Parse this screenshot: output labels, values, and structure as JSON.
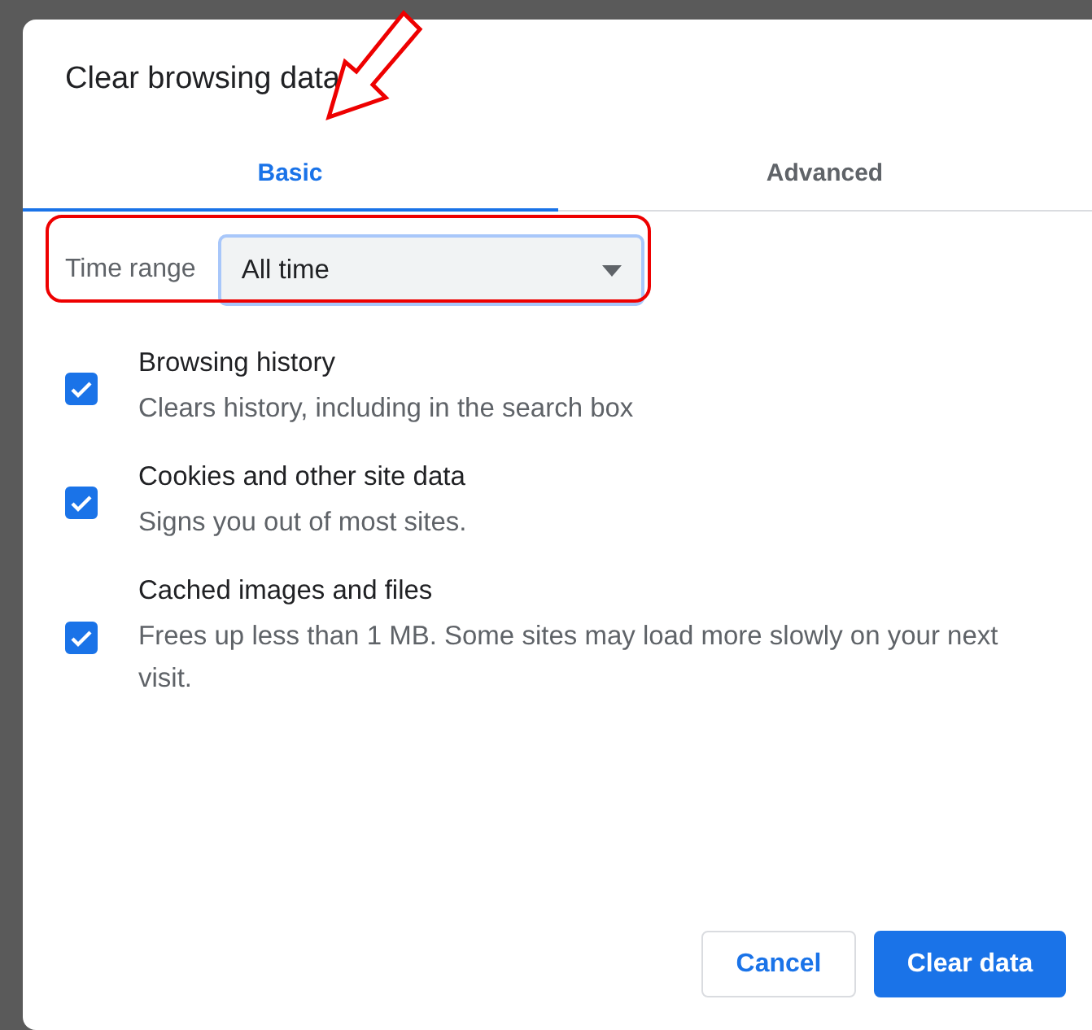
{
  "dialog": {
    "title": "Clear browsing data"
  },
  "tabs": [
    {
      "label": "Basic",
      "selected": true
    },
    {
      "label": "Advanced",
      "selected": false
    }
  ],
  "time_range": {
    "label": "Time range",
    "value": "All time"
  },
  "items": [
    {
      "title": "Browsing history",
      "description": "Clears history, including in the search box",
      "checked": true
    },
    {
      "title": "Cookies and other site data",
      "description": "Signs you out of most sites.",
      "checked": true
    },
    {
      "title": "Cached images and files",
      "description": "Frees up less than 1 MB. Some sites may load more slowly on your next visit.",
      "checked": true
    }
  ],
  "buttons": [
    {
      "label": "Cancel",
      "kind": "secondary"
    },
    {
      "label": "Clear data",
      "kind": "primary"
    }
  ]
}
